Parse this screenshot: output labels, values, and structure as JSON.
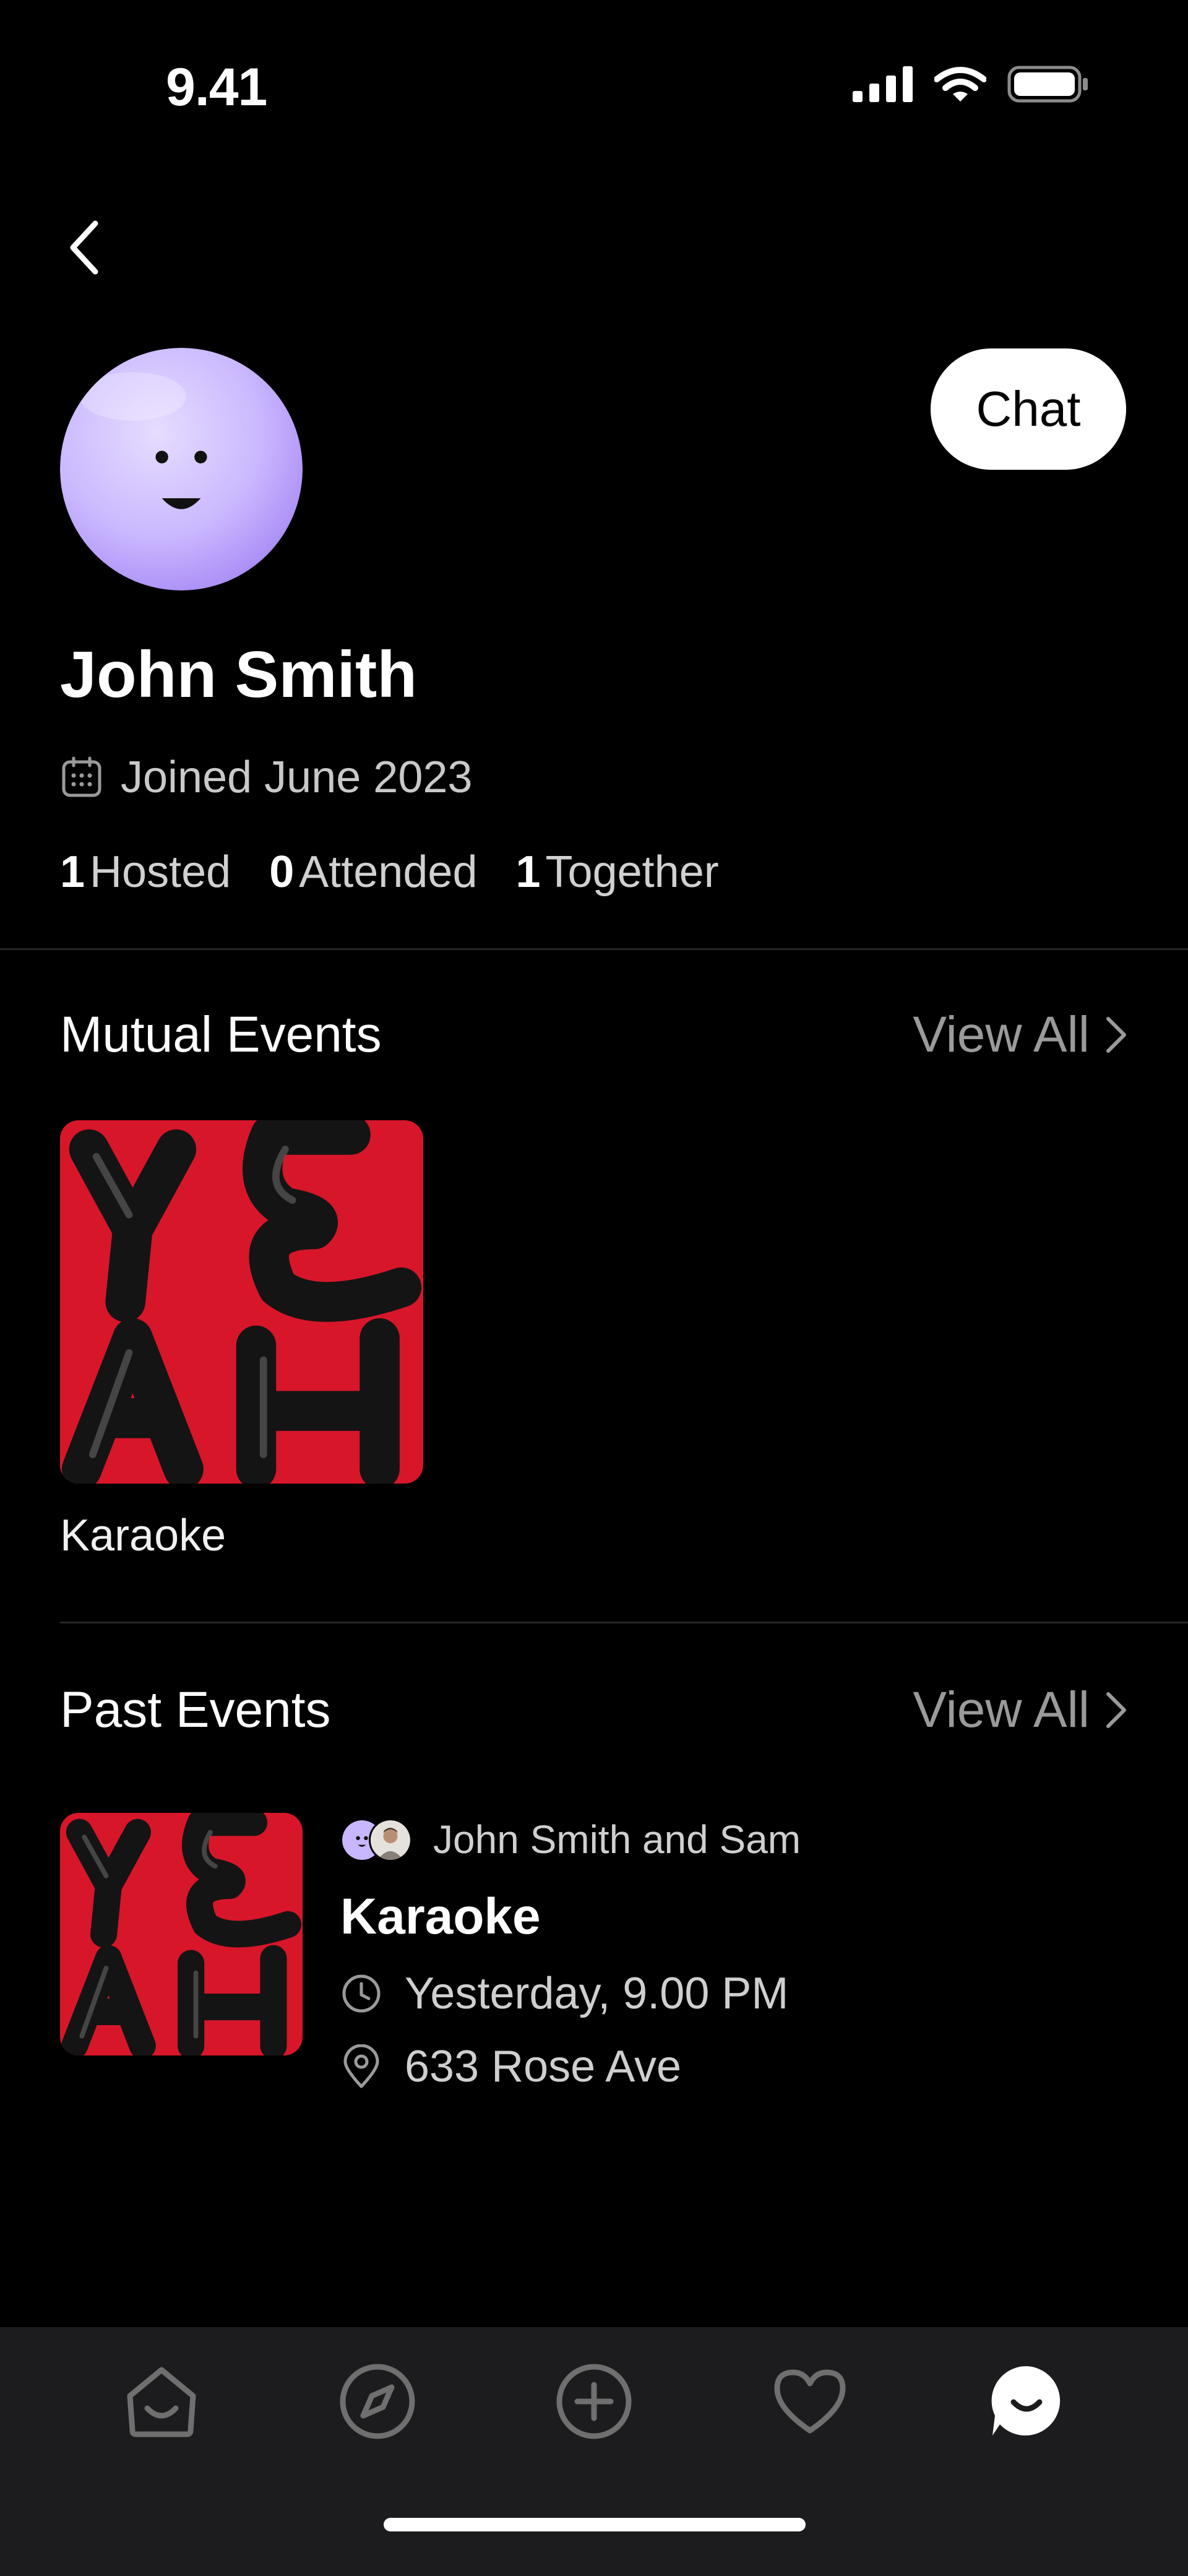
{
  "status_bar": {
    "time": "9.41",
    "icons": [
      "signal-icon",
      "wifi-icon",
      "battery-icon"
    ]
  },
  "header": {
    "back_icon": "chevron-left-icon",
    "chat_label": "Chat"
  },
  "profile": {
    "name": "John Smith",
    "joined": "Joined June 2023",
    "stats": [
      {
        "count": "1",
        "label": "Hosted"
      },
      {
        "count": "0",
        "label": "Attended"
      },
      {
        "count": "1",
        "label": "Together"
      }
    ]
  },
  "mutual_events": {
    "title": "Mutual Events",
    "view_all": "View All",
    "items": [
      {
        "label": "Karaoke"
      }
    ]
  },
  "past_events": {
    "title": "Past Events",
    "view_all": "View All",
    "items": [
      {
        "hosts": "John Smith and Sam",
        "title": "Karaoke",
        "time": "Yesterday, 9.00 PM",
        "location": "633 Rose Ave"
      }
    ]
  },
  "tab_bar": {
    "tabs": [
      "home-icon",
      "explore-icon",
      "create-icon",
      "favorites-icon",
      "chat-icon"
    ],
    "active": "chat-icon"
  },
  "colors": {
    "background": "#000000",
    "tab_bar": "#1c1c1e",
    "avatar": "#c8b6ff",
    "event_art": "#d8162a",
    "secondary_text": "#9a9a9a"
  }
}
